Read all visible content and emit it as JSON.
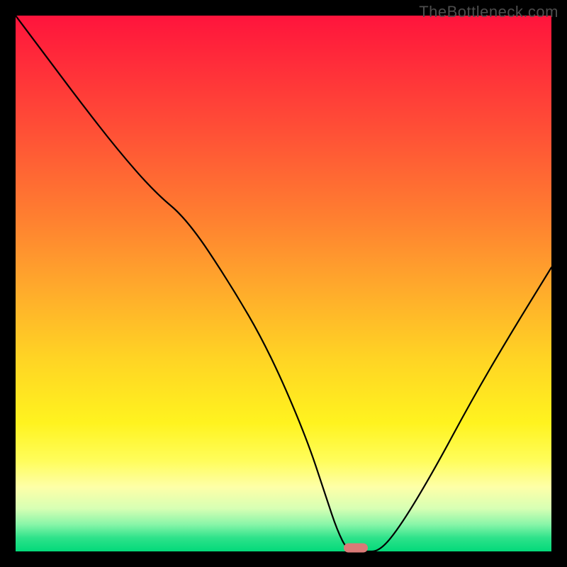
{
  "watermark": "TheBottleneck.com",
  "colors": {
    "marker_fill": "#d97a77",
    "curve_stroke": "#000000"
  },
  "chart_data": {
    "type": "line",
    "title": "",
    "xlabel": "",
    "ylabel": "",
    "xlim": [
      0,
      100
    ],
    "ylim": [
      0,
      100
    ],
    "grid": false,
    "legend": false,
    "series": [
      {
        "name": "bottleneck-curve",
        "x": [
          0,
          6,
          12,
          19,
          26,
          32,
          40,
          47,
          54,
          58,
          60,
          62,
          65,
          68,
          72,
          78,
          85,
          92,
          100
        ],
        "y": [
          100,
          92,
          84,
          75,
          67,
          62,
          50,
          38,
          22,
          10,
          4,
          0,
          0,
          0,
          5,
          15,
          28,
          40,
          53
        ]
      }
    ],
    "annotations": [
      {
        "name": "optimal-marker",
        "x": 63.5,
        "y": 0.6
      }
    ],
    "notes": "V-shaped bottleneck chart over a vertical heat gradient; minimum near x≈62–65."
  }
}
